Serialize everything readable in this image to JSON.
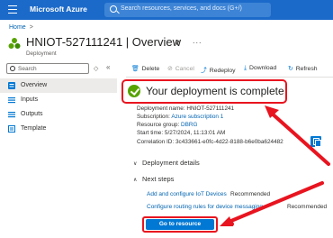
{
  "topbar": {
    "brand": "Microsoft Azure",
    "search_placeholder": "Search resources, services, and docs (G+/)",
    "color": "#1b6ac9"
  },
  "breadcrumb": {
    "home": "Home",
    "separator": ">"
  },
  "header": {
    "title": "HNIOT-527111241 | Overview",
    "subtitle": "Deployment",
    "pin_icon": "pin-icon",
    "more_icon": "ellipsis-icon",
    "more_label": "..."
  },
  "sidebar": {
    "search_placeholder": "Search",
    "items": [
      {
        "label": "Overview",
        "icon": "overview-icon",
        "active": true
      },
      {
        "label": "Inputs",
        "icon": "inputs-icon",
        "active": false
      },
      {
        "label": "Outputs",
        "icon": "outputs-icon",
        "active": false
      },
      {
        "label": "Template",
        "icon": "template-icon",
        "active": false
      }
    ]
  },
  "commandbar": {
    "delete": "Delete",
    "cancel": "Cancel",
    "redeploy": "Redeploy",
    "download": "Download",
    "refresh": "Refresh"
  },
  "status": {
    "headline": "Your deployment is complete",
    "color": "#57a300"
  },
  "details": {
    "deployment_name_label": "Deployment name:",
    "deployment_name": "HNIOT-527111241",
    "subscription_label": "Subscription:",
    "subscription": "Azure subscription 1",
    "resource_group_label": "Resource group:",
    "resource_group": "DBRG",
    "start_time_label": "Start time:",
    "start_time": "5/27/2024, 11:13:01 AM",
    "correlation_id_label": "Correlation ID:",
    "correlation_id": "3c433661-e0fc-4d22-8188-b6e0ba624482"
  },
  "sections": {
    "deployment_details": "Deployment details",
    "next_steps": "Next steps"
  },
  "next_steps": [
    {
      "link": "Add and configure IoT Devices",
      "tag": "Recommended"
    },
    {
      "link": "Configure routing rules for device messaging",
      "tag": "Recommended"
    }
  ],
  "primary_action": {
    "label": "Go to resource",
    "color": "#0078d4"
  },
  "annotation": {
    "color": "#e8141f"
  }
}
